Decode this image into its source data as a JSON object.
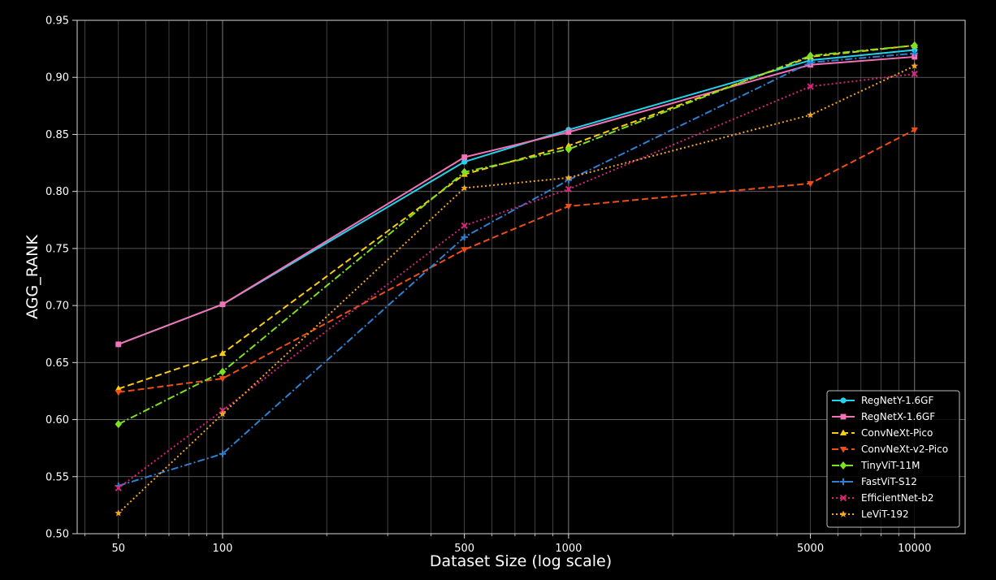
{
  "chart_data": {
    "type": "line",
    "title": "",
    "xlabel": "Dataset Size (log scale)",
    "ylabel": "AGG_RANK",
    "xscale": "log",
    "x": [
      50,
      100,
      500,
      1000,
      5000,
      10000
    ],
    "x_tick_labels": [
      "50",
      "100",
      "500",
      "1000",
      "5000",
      "10000"
    ],
    "y_ticks": [
      0.5,
      0.55,
      0.6,
      0.65,
      0.7,
      0.75,
      0.8,
      0.85,
      0.9,
      0.95
    ],
    "y_tick_labels": [
      "0.50",
      "0.55",
      "0.60",
      "0.65",
      "0.70",
      "0.75",
      "0.80",
      "0.85",
      "0.90",
      "0.95"
    ],
    "xlim": [
      38,
      14000
    ],
    "ylim": [
      0.5,
      0.95
    ],
    "grid": true,
    "background": "#000000",
    "legend_placement": "lower-right",
    "series": [
      {
        "name": "RegNetY-1.6GF",
        "color": "#22d3ee",
        "dash": "solid",
        "marker": "circle",
        "values": [
          0.666,
          0.701,
          0.826,
          0.854,
          0.915,
          0.924
        ]
      },
      {
        "name": "RegNetX-1.6GF",
        "color": "#f472b6",
        "dash": "solid",
        "marker": "square",
        "values": [
          0.666,
          0.701,
          0.83,
          0.852,
          0.911,
          0.918
        ]
      },
      {
        "name": "ConvNeXt-Pico",
        "color": "#facc15",
        "dash": "dashed",
        "marker": "triangle-up",
        "values": [
          0.627,
          0.658,
          0.815,
          0.84,
          0.918,
          0.928
        ]
      },
      {
        "name": "ConvNeXt-v2-Pico",
        "color": "#f04e16",
        "dash": "dashed",
        "marker": "triangle-down",
        "values": [
          0.624,
          0.636,
          0.749,
          0.787,
          0.807,
          0.854
        ]
      },
      {
        "name": "TinyViT-11M",
        "color": "#7ee11f",
        "dash": "dashdot",
        "marker": "diamond",
        "values": [
          0.596,
          0.642,
          0.817,
          0.837,
          0.919,
          0.928
        ]
      },
      {
        "name": "FastViT-S12",
        "color": "#2f80d0",
        "dash": "dashdot",
        "marker": "plus",
        "values": [
          0.542,
          0.57,
          0.76,
          0.81,
          0.913,
          0.921
        ]
      },
      {
        "name": "EfficientNet-b2",
        "color": "#d6267a",
        "dash": "dotted",
        "marker": "x",
        "values": [
          0.54,
          0.608,
          0.77,
          0.802,
          0.892,
          0.903
        ]
      },
      {
        "name": "LeViT-192",
        "color": "#f5a623",
        "dash": "dotted",
        "marker": "star",
        "values": [
          0.518,
          0.605,
          0.803,
          0.812,
          0.867,
          0.91
        ]
      }
    ]
  }
}
